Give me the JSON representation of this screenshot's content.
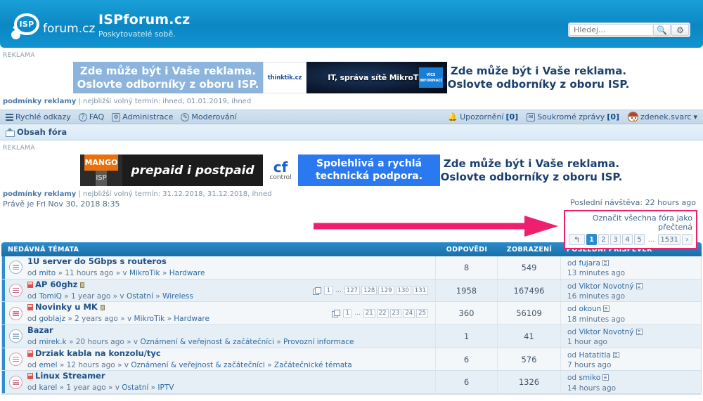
{
  "header": {
    "logo_text": "forum.cz",
    "logo_badge": "ISP",
    "site_title": "ISPforum.cz",
    "site_tagline": "Poskytovatelé sobě.",
    "search_placeholder": "Hledej...",
    "search_value": "",
    "search_icon": "search-icon",
    "settings_icon": "gear-icon",
    "brand_color": "#0b87c4"
  },
  "ads_top": {
    "label": "REKLAMA",
    "banner_left_line1": "Zde může být i Vaše reklama.",
    "banner_left_line2": "Oslovte odborníky z oboru ISP.",
    "thinktik_name": "thinktik.cz",
    "dark_text": "IT, správa sítě MikroTik",
    "dark_button_line1": "VÍCE",
    "dark_button_line2": "INFORMACÍ",
    "banner_right_line1": "Zde může být i Vaše reklama.",
    "banner_right_line2": "Oslovte odborníky z oboru ISP.",
    "conditions_link": "podmínky reklamy",
    "conditions_text": "| nejbližší volný termín: ihned, 01.01.2019, ihned"
  },
  "nav": {
    "items": [
      {
        "label": "Rychlé odkazy",
        "icon": "hamburger-icon"
      },
      {
        "label": "FAQ",
        "icon": "question-icon"
      },
      {
        "label": "Administrace",
        "icon": "admin-icon"
      },
      {
        "label": "Moderování",
        "icon": "moderate-icon"
      }
    ],
    "notifications_label": "Upozornění",
    "notifications_count": "[0]",
    "messages_label": "Soukromé zprávy",
    "messages_count": "[0]",
    "username": "zdenek.svarc",
    "user_caret": "▾"
  },
  "breadcrumb": {
    "label": "Obsah fóra"
  },
  "ads_bottom": {
    "label": "REKLAMA",
    "mango_line1": "MANGO",
    "mango_line2": "ISP",
    "prepaid_text": "prepaid i postpaid",
    "cf_line1": "cf",
    "cf_line2": "control",
    "support_line1": "Spolehlivá a rychlá",
    "support_line2": "technická podpora.",
    "banner_right_line1": "Zde může být i Vaše reklama.",
    "banner_right_line2": "Oslovte odborníky z oboru ISP.",
    "conditions_link": "podmínky reklamy",
    "conditions_text": "| nejbližší volný termín: 31.12.2018, 31.12.2018, ihned"
  },
  "status": {
    "current_time": "Právě je Fri Nov 30, 2018 8:35",
    "last_visit": "Poslední návštěva: 22 hours ago"
  },
  "annotation": {
    "arrow_color": "#ee1f6e",
    "highlight_color": "#ee1f6e"
  },
  "mark_read": {
    "label": "Označit všechna fóra jako přečtená",
    "jump_icon": "jump-arrow-icon",
    "pages": [
      "1",
      "2",
      "3",
      "4",
      "5",
      "…",
      "1531"
    ],
    "active_page": "1",
    "next_label": "›"
  },
  "table": {
    "headers": {
      "topics": "NEDÁVNÁ TÉMATA",
      "replies": "ODPOVĚDI",
      "views": "ZOBRAZENÍ",
      "last_post": "POSLEDNÍ PŘÍSPĚVEK"
    },
    "rows": [
      {
        "title": "1U server do 5Gbps s routeros",
        "new": false,
        "locked": false,
        "author": "mito",
        "age": "11 hours ago",
        "forum": "MikroTik",
        "subforum": "Hardware",
        "pages": [],
        "replies": "8",
        "views": "549",
        "last_author": "fujara",
        "last_when": "13 minutes ago"
      },
      {
        "title": "AP 60ghz",
        "new": true,
        "locked": true,
        "author": "TomiQ",
        "age": "1 year ago",
        "forum": "Ostatní",
        "subforum": "Wireless",
        "pages": [
          "1",
          "…",
          "127",
          "128",
          "129",
          "130",
          "131"
        ],
        "replies": "1958",
        "views": "167496",
        "last_author": "Viktor Novotný",
        "last_when": "16 minutes ago"
      },
      {
        "title": "Novinky u MK",
        "new": true,
        "locked": true,
        "author": "goblajz",
        "age": "2 years ago",
        "forum": "MikroTik",
        "subforum": "Hardware",
        "pages": [
          "1",
          "…",
          "21",
          "22",
          "23",
          "24",
          "25"
        ],
        "replies": "360",
        "views": "56109",
        "last_author": "okoun",
        "last_when": "18 minutes ago"
      },
      {
        "title": "Bazar",
        "new": false,
        "locked": false,
        "author": "mirek.k",
        "age": "20 hours ago",
        "forum": "Oznámení & veřejnost & začátečníci",
        "subforum": "Provozní informace",
        "pages": [],
        "replies": "1",
        "views": "41",
        "last_author": "Viktor Novotný",
        "last_when": "1 hour ago"
      },
      {
        "title": "Drziak kabla na konzolu/tyc",
        "new": true,
        "locked": false,
        "author": "emel",
        "age": "12 hours ago",
        "forum": "Oznámení & veřejnost & začátečníci",
        "subforum": "Začátečnické témata",
        "pages": [],
        "replies": "6",
        "views": "576",
        "last_author": "Hatatitla",
        "last_when": "7 hours ago"
      },
      {
        "title": "Linux Streamer",
        "new": true,
        "locked": false,
        "author": "karel",
        "age": "1 year ago",
        "forum": "Ostatní",
        "subforum": "IPTV",
        "pages": [],
        "replies": "6",
        "views": "1326",
        "last_author": "smiko",
        "last_when": "14 hours ago"
      }
    ]
  }
}
